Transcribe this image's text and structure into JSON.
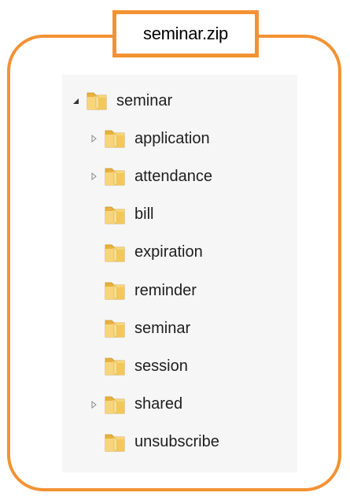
{
  "title": "seminar.zip",
  "tree": {
    "root": {
      "label": "seminar",
      "expanded": true
    },
    "children": [
      {
        "label": "application",
        "has_children": true,
        "expanded": false
      },
      {
        "label": "attendance",
        "has_children": true,
        "expanded": false
      },
      {
        "label": "bill",
        "has_children": false
      },
      {
        "label": "expiration",
        "has_children": false
      },
      {
        "label": "reminder",
        "has_children": false
      },
      {
        "label": "seminar",
        "has_children": false
      },
      {
        "label": "session",
        "has_children": false
      },
      {
        "label": "shared",
        "has_children": true,
        "expanded": false
      },
      {
        "label": "unsubscribe",
        "has_children": false
      }
    ]
  },
  "colors": {
    "accent": "#f39233",
    "panel_bg": "#f6f6f6",
    "folder_yellow": "#f2c85b"
  },
  "icons": {
    "expanded": "triangle-expanded-icon",
    "collapsed": "triangle-collapsed-icon",
    "folder": "folder-icon"
  }
}
